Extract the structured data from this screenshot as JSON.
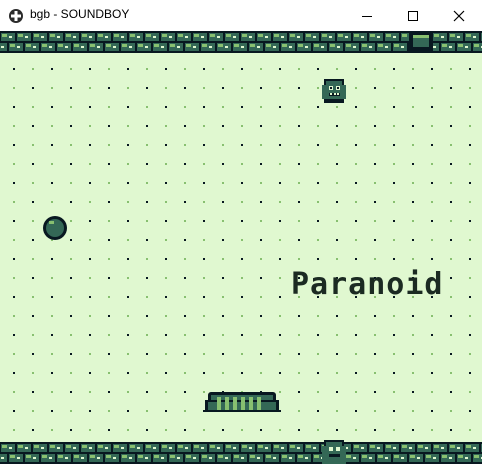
{
  "window": {
    "title": "bgb - SOUNDBOY",
    "icons": {
      "app": "cross-app-icon",
      "minimize": "minimize-icon",
      "maximize": "maximize-icon",
      "close": "close-icon"
    }
  },
  "game": {
    "title_text": "Paranoid",
    "palette": {
      "lightest": "#e0f8d0",
      "light": "#88c070",
      "dark": "#346856",
      "darkest": "#081820"
    },
    "sprites": [
      "ghost-enemy",
      "ball",
      "paddle",
      "bottom-ghost",
      "wall-block"
    ]
  }
}
